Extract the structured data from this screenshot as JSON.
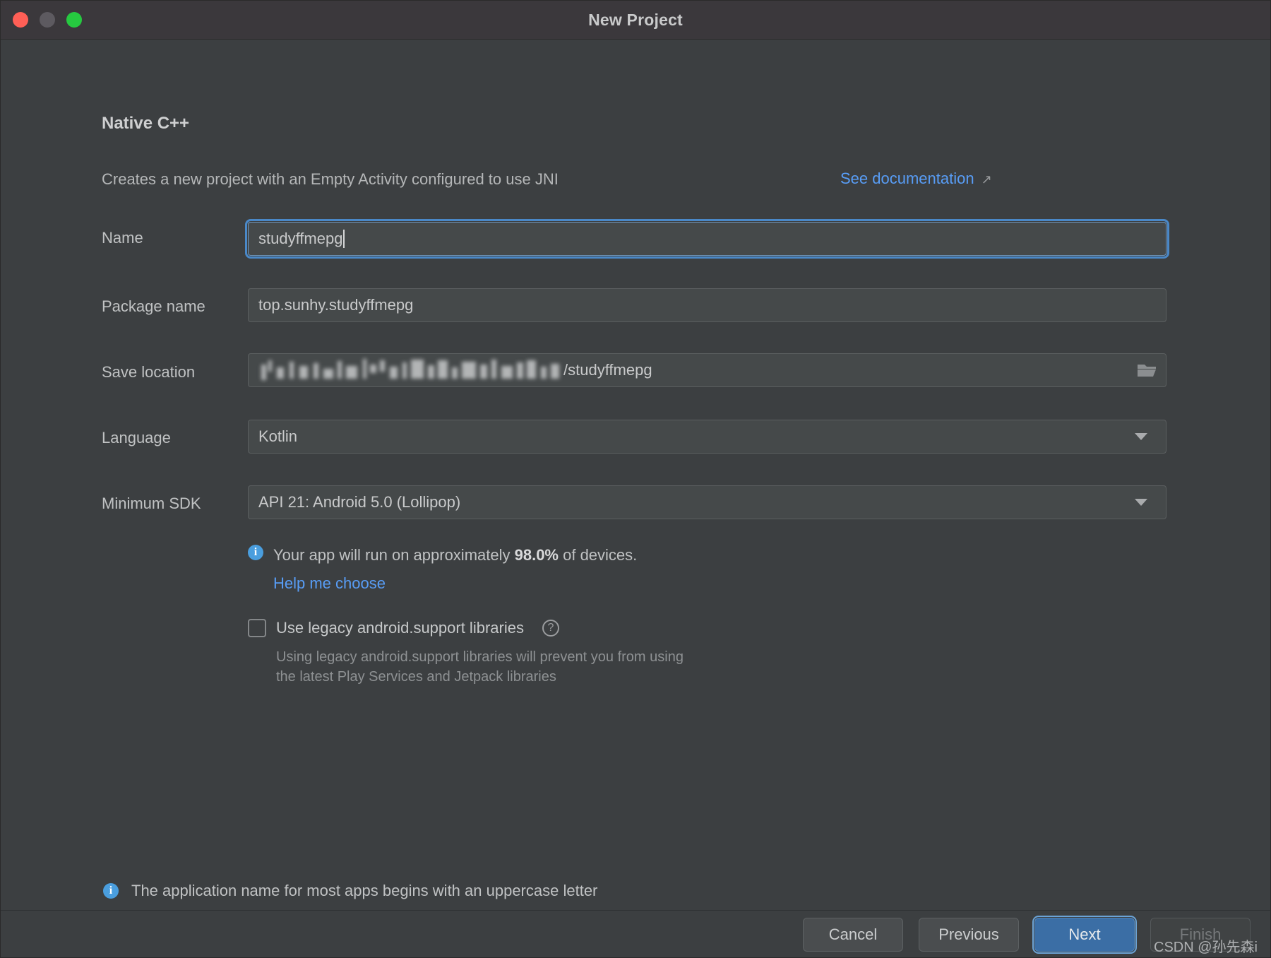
{
  "window": {
    "title": "New Project",
    "traffic_lights": [
      "close",
      "minimize",
      "maximize"
    ]
  },
  "template": {
    "heading": "Native C++",
    "description": "Creates a new project with an Empty Activity configured to use JNI",
    "doc_link": "See documentation",
    "doc_link_arrow": "↗"
  },
  "form": {
    "name": {
      "label": "Name",
      "value": "studyffmepg",
      "focused": true
    },
    "package_name": {
      "label": "Package name",
      "value": "top.sunhy.studyffmepg"
    },
    "save_location": {
      "label": "Save location",
      "value_redacted": true,
      "value_suffix": "/studyffmepg",
      "browse_icon": "folder-icon"
    },
    "language": {
      "label": "Language",
      "value": "Kotlin",
      "arrow_icon": "chevron-down-icon"
    },
    "minimum_sdk": {
      "label": "Minimum SDK",
      "value": "API 21: Android 5.0 (Lollipop)",
      "arrow_icon": "chevron-down-icon"
    }
  },
  "sdk_info": {
    "icon": "info-icon",
    "text_before": "Your app will run on approximately ",
    "percent": "98.0%",
    "text_after": " of devices.",
    "help_link": "Help me choose"
  },
  "legacy": {
    "checked": false,
    "label": "Use legacy android.support libraries",
    "help_icon": "question-mark-icon",
    "description_line1": "Using legacy android.support libraries will prevent you from using",
    "description_line2": "the latest Play Services and Jetpack libraries"
  },
  "bottom_hint": {
    "icon": "info-icon",
    "text": "The application name for most apps begins with an uppercase letter"
  },
  "footer": {
    "cancel": "Cancel",
    "previous": "Previous",
    "next": "Next",
    "finish": "Finish",
    "finish_disabled": true
  },
  "watermark": "CSDN @孙先森i",
  "colors": {
    "window_bg": "#3c3f41",
    "titlebar_bg": "#3b383c",
    "field_bg": "#45494a",
    "accent_link": "#589df6",
    "primary_button": "#3b6ea5",
    "focus_border": "#4a88c7",
    "info_blue": "#4a9ede",
    "traffic_close": "#ff5f56",
    "traffic_min": "#5d5a60",
    "traffic_max": "#26c940"
  }
}
